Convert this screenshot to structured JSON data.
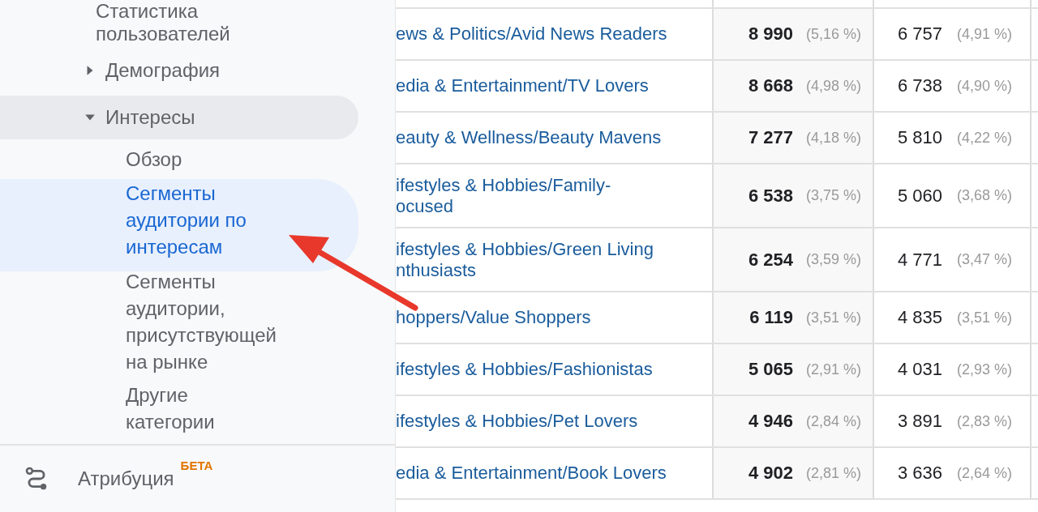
{
  "sidebar": {
    "items": [
      {
        "kind": "heading",
        "lines": [
          "Статистика",
          "пользователей"
        ]
      },
      {
        "kind": "category",
        "label": "Демография",
        "expanded": false,
        "selected": false
      },
      {
        "kind": "category",
        "label": "Интересы",
        "expanded": true,
        "selected": true
      },
      {
        "kind": "link",
        "lines": [
          "Обзор"
        ],
        "selected": false
      },
      {
        "kind": "link",
        "lines": [
          "Сегменты",
          "аудитории по",
          "интересам"
        ],
        "selected": true
      },
      {
        "kind": "link",
        "lines": [
          "Сегменты",
          "аудитории,",
          "присутствующей",
          "на рынке"
        ],
        "selected": false
      },
      {
        "kind": "link",
        "lines": [
          "Другие",
          "категории"
        ],
        "selected": false
      }
    ],
    "footer": {
      "label": "Атрибуция",
      "badge": "БЕТА"
    }
  },
  "table": {
    "rows": [
      {
        "segment": [
          "ews & Politics/Avid News Readers"
        ],
        "users": "8 990",
        "users_pct": "(5,16 %)",
        "new_users": "6 757",
        "new_users_pct": "(4,91 %)"
      },
      {
        "segment": [
          "edia & Entertainment/TV Lovers"
        ],
        "users": "8 668",
        "users_pct": "(4,98 %)",
        "new_users": "6 738",
        "new_users_pct": "(4,90 %)"
      },
      {
        "segment": [
          "eauty & Wellness/Beauty Mavens"
        ],
        "users": "7 277",
        "users_pct": "(4,18 %)",
        "new_users": "5 810",
        "new_users_pct": "(4,22 %)"
      },
      {
        "segment": [
          "ifestyles & Hobbies/Family-",
          "ocused"
        ],
        "users": "6 538",
        "users_pct": "(3,75 %)",
        "new_users": "5 060",
        "new_users_pct": "(3,68 %)"
      },
      {
        "segment": [
          "ifestyles & Hobbies/Green Living",
          "nthusiasts"
        ],
        "users": "6 254",
        "users_pct": "(3,59 %)",
        "new_users": "4 771",
        "new_users_pct": "(3,47 %)"
      },
      {
        "segment": [
          "hoppers/Value Shoppers"
        ],
        "users": "6 119",
        "users_pct": "(3,51 %)",
        "new_users": "4 835",
        "new_users_pct": "(3,51 %)"
      },
      {
        "segment": [
          "ifestyles & Hobbies/Fashionistas"
        ],
        "users": "5 065",
        "users_pct": "(2,91 %)",
        "new_users": "4 031",
        "new_users_pct": "(2,93 %)"
      },
      {
        "segment": [
          "ifestyles & Hobbies/Pet Lovers"
        ],
        "users": "4 946",
        "users_pct": "(2,84 %)",
        "new_users": "3 891",
        "new_users_pct": "(2,83 %)"
      },
      {
        "segment": [
          "edia & Entertainment/Book Lovers"
        ],
        "users": "4 902",
        "users_pct": "(2,81 %)",
        "new_users": "3 636",
        "new_users_pct": "(2,64 %)"
      }
    ]
  }
}
